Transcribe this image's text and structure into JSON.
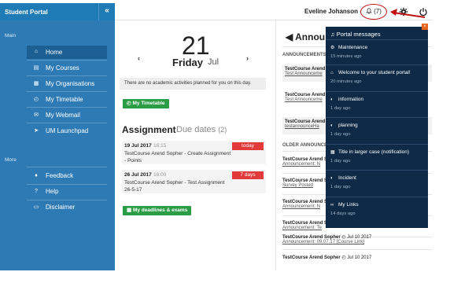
{
  "header": {
    "brand": "Student Portal",
    "collapse_glyph": "«",
    "username": "Eveline Johanson",
    "notifications_label": "(7)"
  },
  "sidebar": {
    "main_label": "Main",
    "more_label": "More",
    "items": [
      {
        "label": "Home",
        "icon": "home-icon",
        "glyph": "⌂"
      },
      {
        "label": "My Courses",
        "icon": "book-icon",
        "glyph": "▤"
      },
      {
        "label": "My Organisations",
        "icon": "building-icon",
        "glyph": "▦"
      },
      {
        "label": "My Timetable",
        "icon": "clock-icon",
        "glyph": "◴"
      },
      {
        "label": "My Webmail",
        "icon": "envelope-icon",
        "glyph": "✉"
      },
      {
        "label": "UM Launchpad",
        "icon": "rocket-icon",
        "glyph": "➤"
      }
    ],
    "more_items": [
      {
        "label": "Feedback",
        "icon": "microphone-icon",
        "glyph": "♦"
      },
      {
        "label": "Help",
        "icon": "question-icon",
        "glyph": "?"
      },
      {
        "label": "Disclaimer",
        "icon": "document-icon",
        "glyph": "▭"
      }
    ]
  },
  "main": {
    "prev_glyph": "‹",
    "next_glyph": "›",
    "day": "21",
    "weekday": "Friday",
    "month": "Jul",
    "no_activities": "There are no academic activities planned for you on this day.",
    "timetable_button": "My Timetable",
    "assignment_title": "Assignment",
    "assignment_subtitle": "Due dates",
    "assignment_count": "(2)",
    "assignments": [
      {
        "date": "19 Jul 2017",
        "time": "16:15",
        "title": "TestCourse Arend Sopher - Create Assignment - Points",
        "badge": "today"
      },
      {
        "date": "26 Jul 2017",
        "time": "16:00",
        "title": "TestCourse Arend Sopher - Test Assignment 26-5-17",
        "badge": "7 days"
      }
    ],
    "deadlines_button": "My deadlines & exams"
  },
  "announcements": {
    "title": "Annou",
    "announcements_head": "ANNOUNCEMENTS",
    "older_head": "OLDER ANNOUNCE",
    "items": [
      {
        "t": "TestCourse Arend",
        "l": "Test Announceme"
      },
      {
        "t": "TestCourse Arend",
        "l": "Test Announceme"
      },
      {
        "t": "TestCourse Arend",
        "l": "testannounceHa"
      }
    ],
    "older": [
      {
        "t": "TestCourse Arend S",
        "l": "Announcement: N"
      },
      {
        "t": "TestCourse Arend S",
        "l": "Survey Posted"
      },
      {
        "t": "TestCourse Arend S",
        "l": "Announcement: N"
      },
      {
        "t": "TestCourse Arend S",
        "l": "Announcement: Te"
      }
    ],
    "footer_items": [
      {
        "t": "TestCourse Arend Sopher",
        "d": "Jul 10 2017",
        "l": "Announcement: 09.07.17 [Course Link]"
      },
      {
        "t": "TestCourse Arend Sopher",
        "d": "Jul 10 2017",
        "l": ""
      }
    ]
  },
  "popup": {
    "title": "Portal messages",
    "close_glyph": "×",
    "messages": [
      {
        "title": "Maintenance",
        "time": "15 minutes ago",
        "icon": "gears-icon",
        "glyph": "⚙"
      },
      {
        "title": "Welcome to your student portal!",
        "time": "20 minutes ago",
        "icon": "home-icon",
        "glyph": "⌂"
      },
      {
        "title": "information",
        "time": "1 day ago",
        "icon": "half-circle-icon",
        "glyph": "◐"
      },
      {
        "title": "planning",
        "time": "1 day ago",
        "icon": "half-circle-icon",
        "glyph": "◐"
      },
      {
        "title": "Title in larger case (notification)",
        "time": "1 day ago",
        "icon": "calendar-icon",
        "glyph": "▦"
      },
      {
        "title": "Incident",
        "time": "1 day ago",
        "icon": "half-circle-icon",
        "glyph": "◐"
      },
      {
        "title": "My Links",
        "time": "14 days ago",
        "icon": "link-icon",
        "glyph": "∞"
      }
    ]
  },
  "colors": {
    "sidebar": "#2d7ab5",
    "popup": "#0e2a47",
    "green": "#2a9d46",
    "red_badge": "#e23a3a",
    "highlight": "#c01010"
  }
}
